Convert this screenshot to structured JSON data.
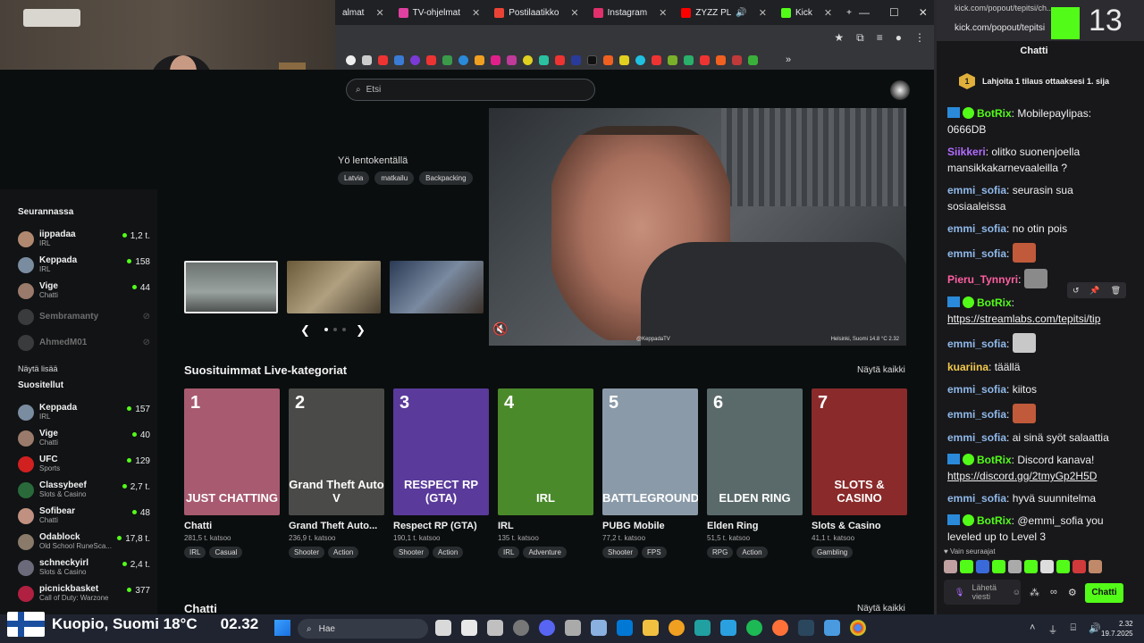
{
  "browser": {
    "tabs": [
      {
        "label": "almat",
        "color": "#ff2020"
      },
      {
        "label": "TV-ohjelmat",
        "color": "#e040a0"
      },
      {
        "label": "Postilaatikko",
        "color": "#ea4335"
      },
      {
        "label": "Instagram",
        "color": "#e1306c"
      },
      {
        "label": "ZYZZ PL",
        "color": "#ff0000"
      },
      {
        "label": "Kick",
        "color": "#53fc18"
      }
    ],
    "new_tab": "+",
    "minimize": "—",
    "maximize": "☐",
    "close": "✕"
  },
  "search": {
    "placeholder": "Etsi"
  },
  "featured": {
    "title": "Yö lentokentällä",
    "tags": [
      "Latvia",
      "matkailu",
      "Backpacking"
    ],
    "overlay_left": "@KeppadaTV",
    "overlay_right": "Helsinki, Suomi 14.8 °C  2.32"
  },
  "sidebar": {
    "following_heading": "Seurannassa",
    "following": [
      {
        "name": "iippadaa",
        "category": "IRL",
        "count": "1,2 t.",
        "live": true
      },
      {
        "name": "Keppada",
        "category": "IRL",
        "count": "158",
        "live": true
      },
      {
        "name": "Vige",
        "category": "Chatti",
        "count": "44",
        "live": true
      },
      {
        "name": "Sembramanty",
        "category": "",
        "count": "",
        "live": false
      },
      {
        "name": "AhmedM01",
        "category": "",
        "count": "",
        "live": false
      }
    ],
    "show_more": "Näytä lisää",
    "recommended_heading": "Suositellut",
    "recommended": [
      {
        "name": "Keppada",
        "category": "IRL",
        "count": "157"
      },
      {
        "name": "Vige",
        "category": "Chatti",
        "count": "40"
      },
      {
        "name": "UFC",
        "category": "Sports",
        "count": "129"
      },
      {
        "name": "Classybeef",
        "category": "Slots & Casino",
        "count": "2,7 t."
      },
      {
        "name": "Sofibear",
        "category": "Chatti",
        "count": "48"
      },
      {
        "name": "Odablock",
        "category": "Old School RuneSca...",
        "count": "17,8 t."
      },
      {
        "name": "schneckyirl",
        "category": "Slots & Casino",
        "count": "2,4 t."
      },
      {
        "name": "picnickbasket",
        "category": "Call of Duty: Warzone",
        "count": "377"
      }
    ]
  },
  "categories": {
    "heading": "Suosituimmat Live-kategoriat",
    "show_all": "Näytä kaikki",
    "items": [
      {
        "rank": "1",
        "name": "Chatti",
        "viewers": "281,5 t. katsoo",
        "tags": [
          "IRL",
          "Casual"
        ],
        "art": "JUST CHATTING",
        "bg": "#a85a70"
      },
      {
        "rank": "2",
        "name": "Grand Theft Auto...",
        "viewers": "236,9 t. katsoo",
        "tags": [
          "Shooter",
          "Action"
        ],
        "art": "Grand Theft Auto V",
        "bg": "#4a4a48"
      },
      {
        "rank": "3",
        "name": "Respect RP (GTA)",
        "viewers": "190,1 t. katsoo",
        "tags": [
          "Shooter",
          "Action"
        ],
        "art": "RESPECT RP (GTA)",
        "bg": "#5a3a9a"
      },
      {
        "rank": "4",
        "name": "IRL",
        "viewers": "135 t. katsoo",
        "tags": [
          "IRL",
          "Adventure"
        ],
        "art": "IRL",
        "bg": "#4a8a2a"
      },
      {
        "rank": "5",
        "name": "PUBG Mobile",
        "viewers": "77,2 t. katsoo",
        "tags": [
          "Shooter",
          "FPS"
        ],
        "art": "BATTLEGROUNDS",
        "bg": "#8a9aa8"
      },
      {
        "rank": "6",
        "name": "Elden Ring",
        "viewers": "51,5 t. katsoo",
        "tags": [
          "RPG",
          "Action"
        ],
        "art": "ELDEN RING",
        "bg": "#5a6a6a"
      },
      {
        "rank": "7",
        "name": "Slots & Casino",
        "viewers": "41,1 t. katsoo",
        "tags": [
          "Gambling"
        ],
        "art": "SLOTS & CASINO",
        "bg": "#8a2a2a"
      }
    ]
  },
  "chat_section": {
    "heading": "Chatti",
    "show_all": "Näytä kaikki"
  },
  "popout": {
    "url_top": "kick.com/popout/tepitsi/ch...",
    "url": "kick.com/popout/tepitsi",
    "viewer_count": "13",
    "title": "Chatti",
    "gift_badge": "1",
    "gift_text": "Lahjoita 1 tilaus ottaaksesi 1. sija",
    "messages": [
      {
        "user": "BotRix",
        "color": "#53fc18",
        "bot": true,
        "text": "Mobilepaylipas: 0666DB"
      },
      {
        "user": "Siikkeri",
        "color": "#b36cff",
        "text": "olitko suonenjoella mansikkakarnevaaleilla ?"
      },
      {
        "user": "emmi_sofia",
        "color": "#8fb8e8",
        "text": "seurasin sua sosiaaleissa"
      },
      {
        "user": "emmi_sofia",
        "color": "#8fb8e8",
        "text": "no otin pois"
      },
      {
        "user": "emmi_sofia",
        "color": "#8fb8e8",
        "text": "",
        "emote": "#c05a3a"
      },
      {
        "user": "Pieru_Tynnyri",
        "color": "#ff5fa0",
        "text": "",
        "emote": "#8a8a8a"
      },
      {
        "user": "BotRix",
        "color": "#53fc18",
        "bot": true,
        "text": "",
        "link": "https://streamlabs.com/tepitsi/tip"
      },
      {
        "user": "emmi_sofia",
        "color": "#8fb8e8",
        "text": "",
        "emote": "#c8c8c8"
      },
      {
        "user": "kuariina",
        "color": "#f2c94c",
        "text": "täällä"
      },
      {
        "user": "emmi_sofia",
        "color": "#8fb8e8",
        "text": "kiitos"
      },
      {
        "user": "emmi_sofia",
        "color": "#8fb8e8",
        "text": "",
        "emote": "#c05a3a"
      },
      {
        "user": "emmi_sofia",
        "color": "#8fb8e8",
        "text": "ai sinä syöt salaattia"
      },
      {
        "user": "BotRix",
        "color": "#53fc18",
        "bot": true,
        "text": "Discord kanava!",
        "link": "https://discord.gg/2tmyGp2H5D"
      },
      {
        "user": "emmi_sofia",
        "color": "#8fb8e8",
        "text": "hyvä suunnitelma"
      },
      {
        "user": "BotRix",
        "color": "#53fc18",
        "bot": true,
        "text": "@emmi_sofia you leveled up to Level 3"
      }
    ],
    "followers_only": "Vain seuraajat",
    "input_placeholder": "Lähetä viesti",
    "send_label": "Chatti"
  },
  "overlay": {
    "location": "Kuopio, Suomi 18°C",
    "time": "02.32"
  },
  "taskbar": {
    "search_placeholder": "Hae",
    "clock_time": "2.32",
    "clock_date": "19.7.2025"
  }
}
